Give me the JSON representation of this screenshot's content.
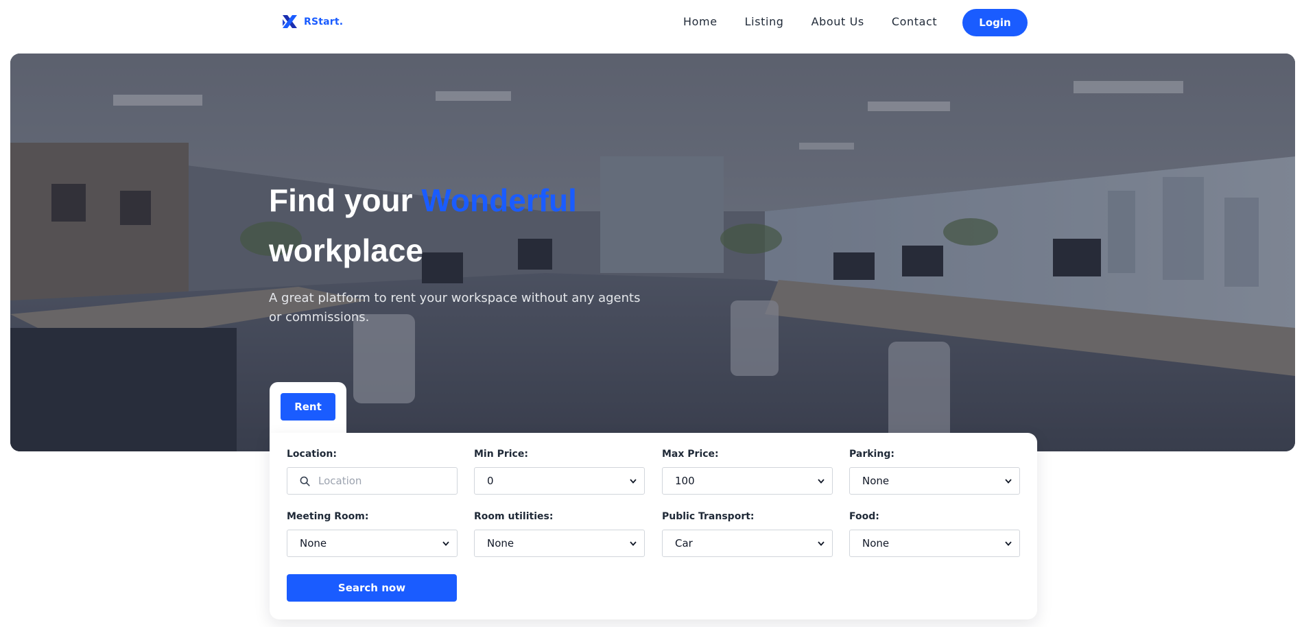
{
  "brand": {
    "name": "RStart."
  },
  "nav": {
    "items": [
      "Home",
      "Listing",
      "About Us",
      "Contact"
    ],
    "login_label": "Login"
  },
  "hero": {
    "title_part1": "Find your ",
    "title_accent": "Wonderful",
    "title_part2": "workplace",
    "subtitle": "A great platform to rent your workspace without any agents or commissions."
  },
  "search": {
    "tab_label": "Rent",
    "location": {
      "label": "Location:",
      "placeholder": "Location",
      "value": ""
    },
    "min_price": {
      "label": "Min Price:",
      "value": "0"
    },
    "max_price": {
      "label": "Max Price:",
      "value": "100"
    },
    "parking": {
      "label": "Parking:",
      "value": "None"
    },
    "meeting_room": {
      "label": "Meeting Room:",
      "value": "None"
    },
    "room_utilities": {
      "label": "Room utilities:",
      "value": "None"
    },
    "public_transport": {
      "label": "Public Transport:",
      "value": "Car"
    },
    "food": {
      "label": "Food:",
      "value": "None"
    },
    "submit_label": "Search now"
  },
  "colors": {
    "accent": "#1a5cff",
    "text": "#1f2937",
    "hero_overlay": "#23283a"
  },
  "icons": {
    "brand": "brand-logo-icon",
    "search": "search-icon",
    "dropdown": "chevron-down-icon"
  }
}
